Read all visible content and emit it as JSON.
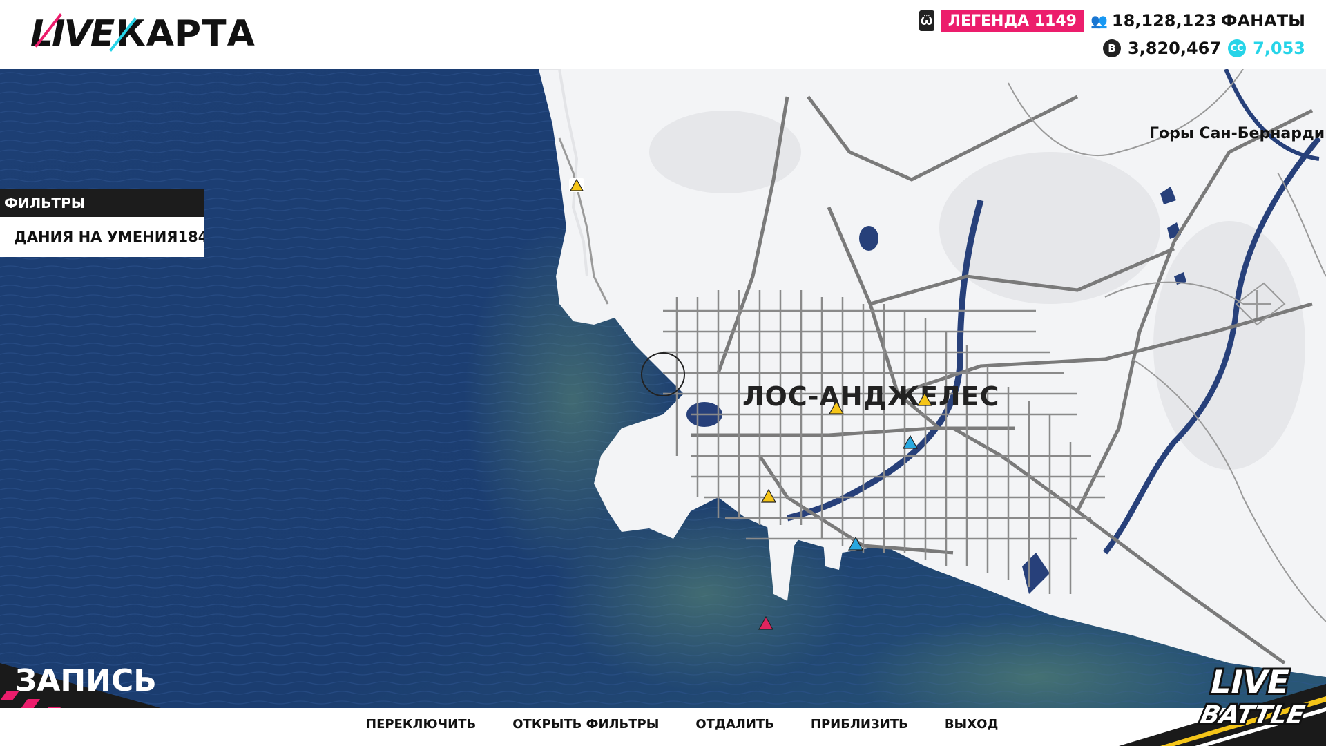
{
  "header": {
    "logo_live": "LIVE",
    "logo_title": "КАРТА",
    "rank_label": "ЛЕГЕНДА 1149",
    "fans_value": "18,128,123",
    "fans_label": "ФАНАТЫ",
    "credits_value": "3,820,467",
    "cc_value": "7,053"
  },
  "filters": {
    "title": "ФИЛЬТРЫ",
    "item_label": "ДАНИЯ НА УМЕНИЯ",
    "item_count": "184"
  },
  "map": {
    "city_label": "ЛОС-АНДЖЕЛЕС",
    "region_label": "Горы Сан-Бернардино",
    "record_label": "ЗАПИСЬ"
  },
  "actions": [
    "ПЕРЕКЛЮЧИТЬ",
    "ОТКРЫТЬ ФИЛЬТРЫ",
    "ОТДАЛИТЬ",
    "ПРИБЛИЗИТЬ",
    "ВЫХОД"
  ],
  "corner_logo": {
    "line1": "LIVE",
    "line2": "BATTLE"
  },
  "colors": {
    "accent_pink": "#ec1d6c",
    "accent_cyan": "#26d4e8",
    "ocean": "#1b3a6b",
    "land": "#f3f4f6",
    "road": "#7a7a7a",
    "pin_yellow": "#f5c518",
    "pin_blue": "#29a8e0",
    "pin_red": "#e0245e"
  },
  "pins": [
    {
      "type": "skill-yellow-icon"
    },
    {
      "type": "skill-yellow-icon"
    },
    {
      "type": "skill-yellow-icon"
    },
    {
      "type": "skill-yellow-icon"
    },
    {
      "type": "skill-blue-icon"
    },
    {
      "type": "skill-blue-icon"
    },
    {
      "type": "skill-red-icon"
    }
  ]
}
